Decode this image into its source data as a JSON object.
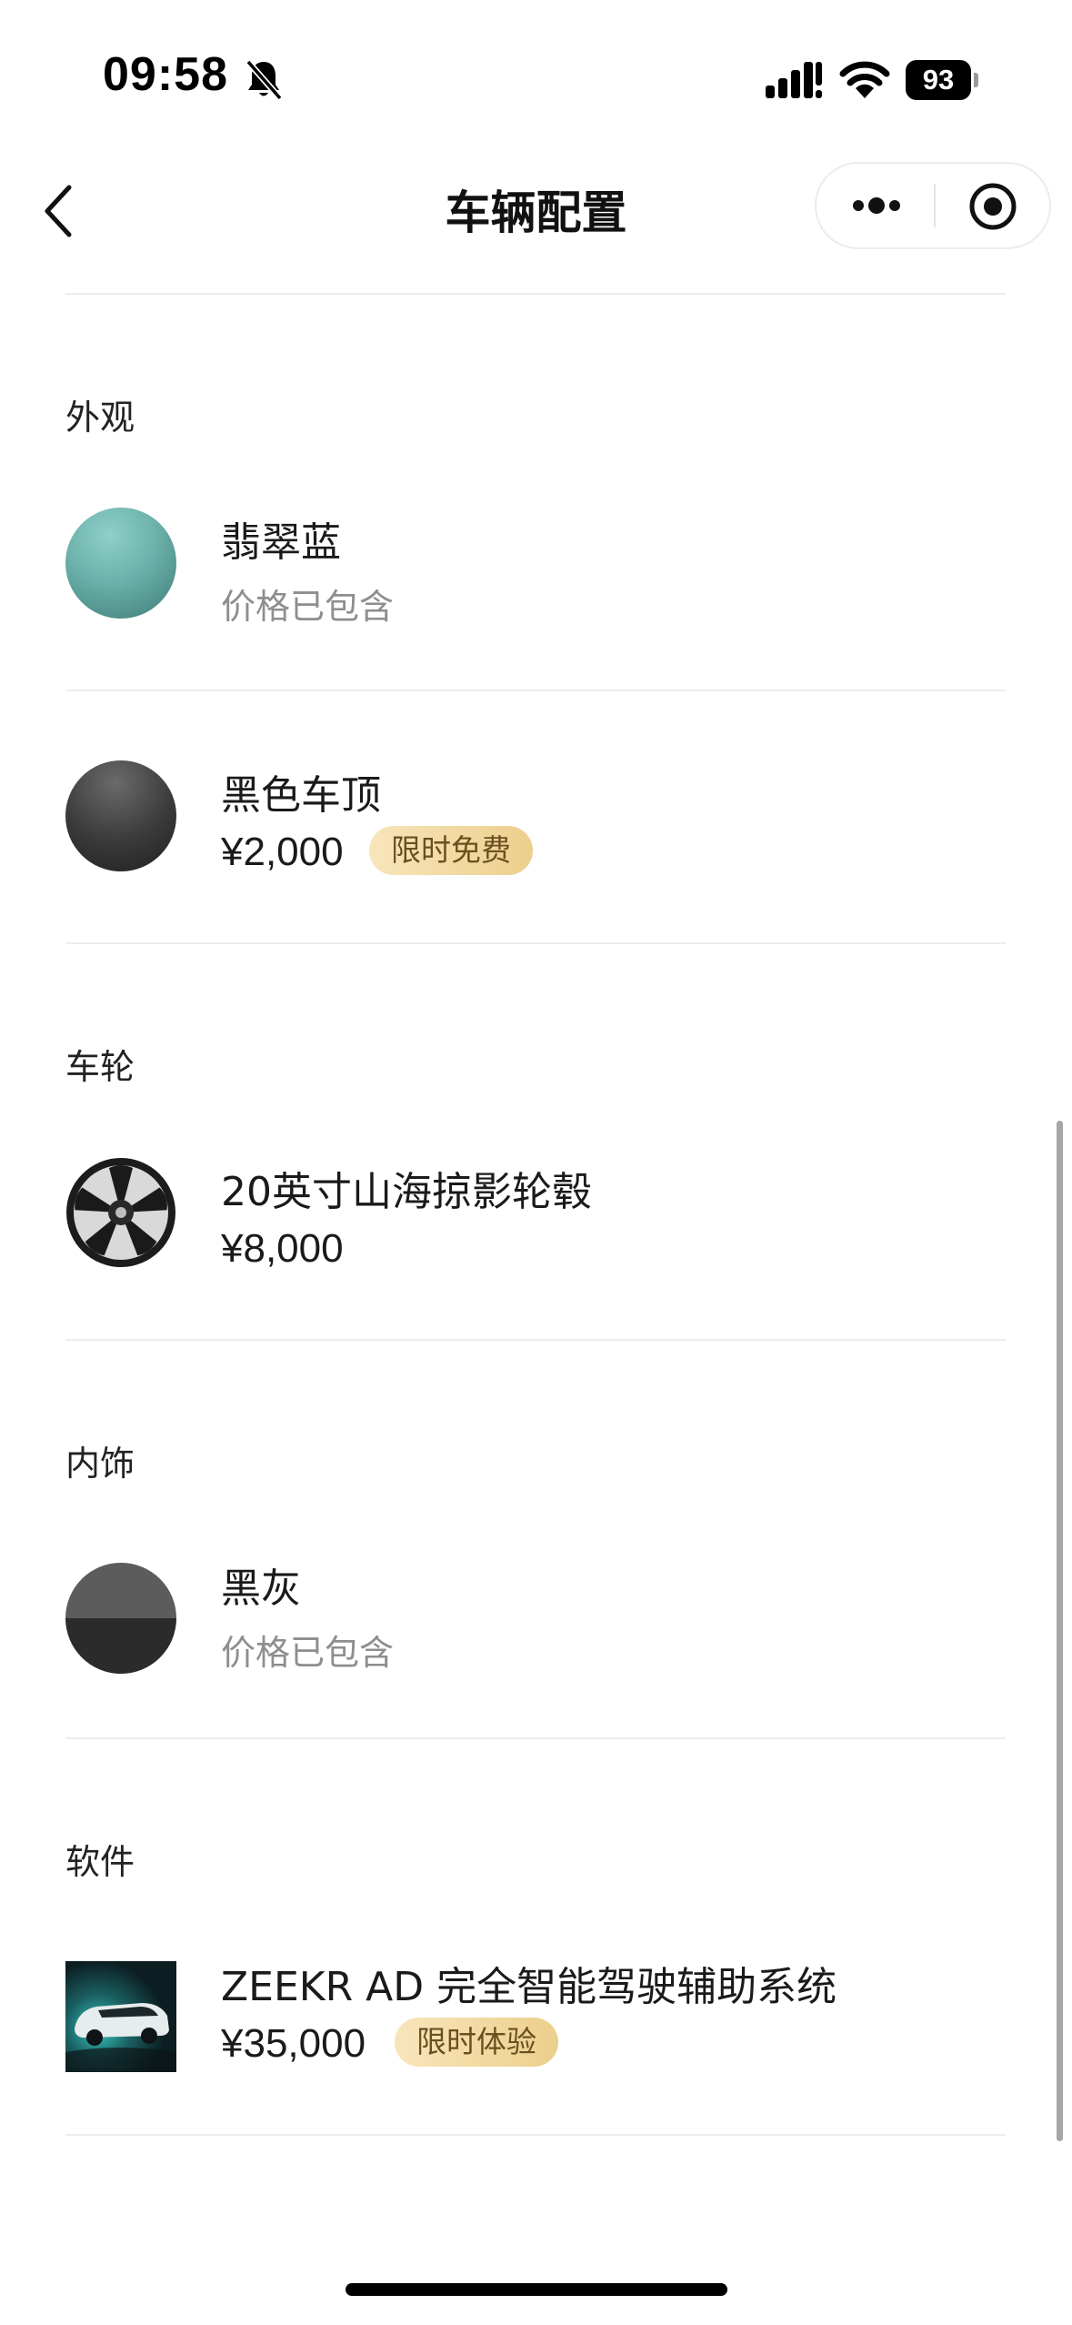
{
  "status_bar": {
    "time": "09:58",
    "battery": "93",
    "icons": [
      "bell-slash-icon",
      "signal-icon",
      "wifi-icon",
      "battery-icon"
    ]
  },
  "nav": {
    "title": "车辆配置",
    "back_icon": "chevron-left-icon",
    "more_icon": "more-dots-icon",
    "close_icon": "target-circle-icon"
  },
  "sections": {
    "exterior": {
      "title": "外观",
      "items": [
        {
          "name": "翡翠蓝",
          "price": "价格已包含",
          "swatch_color": "#6fb2ad"
        },
        {
          "name": "黑色车顶",
          "price": "¥2,000",
          "badge": "限时免费",
          "swatch_color": "#333333"
        }
      ]
    },
    "wheels": {
      "title": "车轮",
      "items": [
        {
          "name": "20英寸山海掠影轮毂",
          "price": "¥8,000",
          "image": "wheel-rim-icon"
        }
      ]
    },
    "interior": {
      "title": "内饰",
      "items": [
        {
          "name": "黑灰",
          "price": "价格已包含",
          "swatch_colors": [
            "#5a5a5a",
            "#2b2b2b"
          ]
        }
      ]
    },
    "software": {
      "title": "软件",
      "items": [
        {
          "name": "ZEEKR AD 完全智能驾驶辅助系统",
          "price": "¥35,000",
          "badge": "限时体验",
          "image": "car-thumbnail"
        }
      ]
    }
  },
  "colors": {
    "badge_bg_start": "#f8e5bb",
    "badge_bg_end": "#eccf8c",
    "badge_text": "#6a5020",
    "muted_text": "#8e8e8e",
    "divider": "#ededed"
  }
}
